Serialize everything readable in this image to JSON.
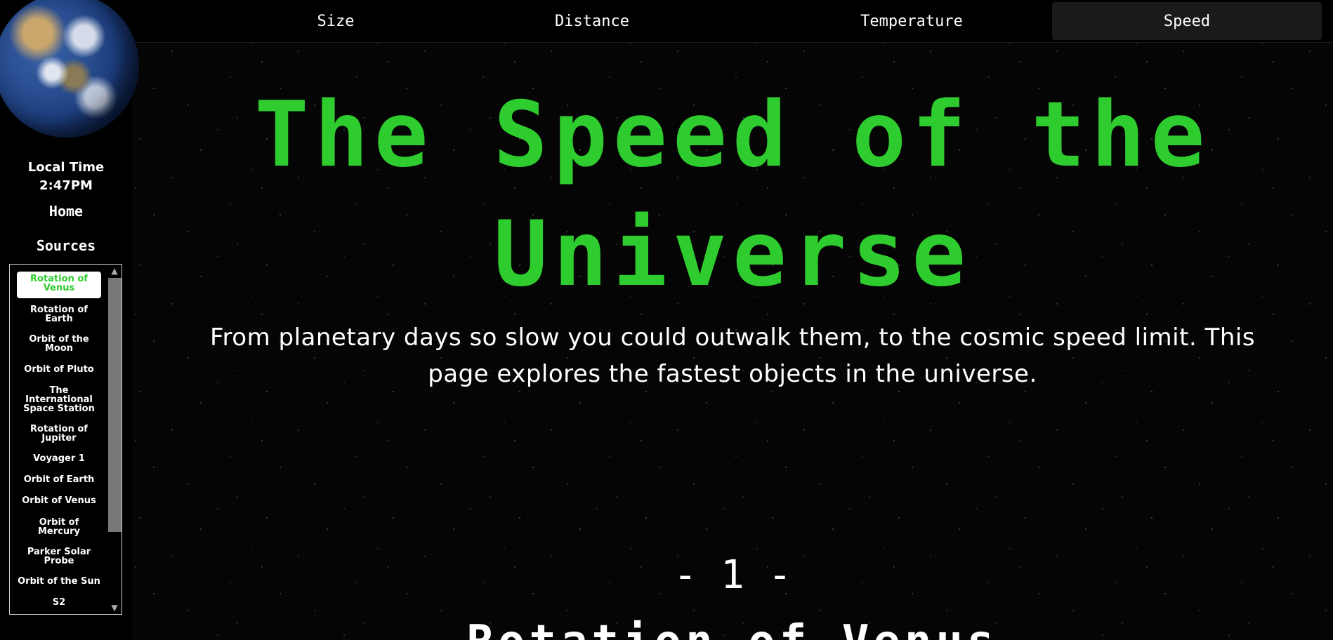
{
  "nav": {
    "tabs": [
      {
        "label": "Size",
        "active": false
      },
      {
        "label": "Distance",
        "active": false
      },
      {
        "label": "Temperature",
        "active": false
      },
      {
        "label": "Speed",
        "active": true
      }
    ]
  },
  "sidebar": {
    "local_time_label": "Local Time",
    "local_time_value": "2:47PM",
    "home_label": "Home",
    "sources_label": "Sources",
    "sources": [
      {
        "label": "Rotation of Venus",
        "active": true
      },
      {
        "label": "Rotation of Earth",
        "active": false
      },
      {
        "label": "Orbit of the Moon",
        "active": false
      },
      {
        "label": "Orbit of Pluto",
        "active": false
      },
      {
        "label": "The International Space Station",
        "active": false
      },
      {
        "label": "Rotation of Jupiter",
        "active": false
      },
      {
        "label": "Voyager 1",
        "active": false
      },
      {
        "label": "Orbit of Earth",
        "active": false
      },
      {
        "label": "Orbit of Venus",
        "active": false
      },
      {
        "label": "Orbit of Mercury",
        "active": false
      },
      {
        "label": "Parker Solar Probe",
        "active": false
      },
      {
        "label": "Orbit of the Sun",
        "active": false
      },
      {
        "label": "S2",
        "active": false
      }
    ]
  },
  "main": {
    "title": "The Speed of the Universe",
    "subtitle": "From planetary days so slow you could outwalk them, to the cosmic speed limit. This page explores the fastest objects in the universe.",
    "section_number": "- 1 -",
    "section_title": "Rotation of Venus"
  },
  "colors": {
    "accent": "#2ecc2e",
    "background": "#000000",
    "text": "#ffffff"
  }
}
